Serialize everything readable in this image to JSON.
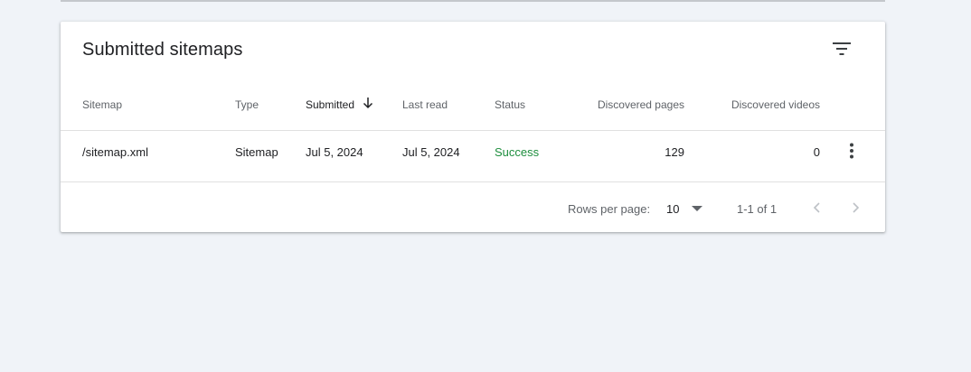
{
  "card": {
    "title": "Submitted sitemaps"
  },
  "table": {
    "columns": [
      "Sitemap",
      "Type",
      "Submitted",
      "Last read",
      "Status",
      "Discovered pages",
      "Discovered videos"
    ],
    "rows": [
      {
        "sitemap": "/sitemap.xml",
        "type": "Sitemap",
        "submitted": "Jul 5, 2024",
        "last_read": "Jul 5, 2024",
        "status": "Success",
        "discovered_pages": "129",
        "discovered_videos": "0"
      }
    ]
  },
  "pagination": {
    "rows_per_page_label": "Rows per page:",
    "rows_per_page_value": "10",
    "range_text": "1-1 of 1"
  },
  "colors": {
    "background": "#f0f3f8",
    "success": "#1e8e3e",
    "muted_text": "#5f6368",
    "primary_text": "#202124"
  },
  "icons": [
    "filter-icon",
    "arrow-down-icon",
    "more-vert-icon",
    "caret-down-icon",
    "chevron-left-icon",
    "chevron-right-icon"
  ]
}
